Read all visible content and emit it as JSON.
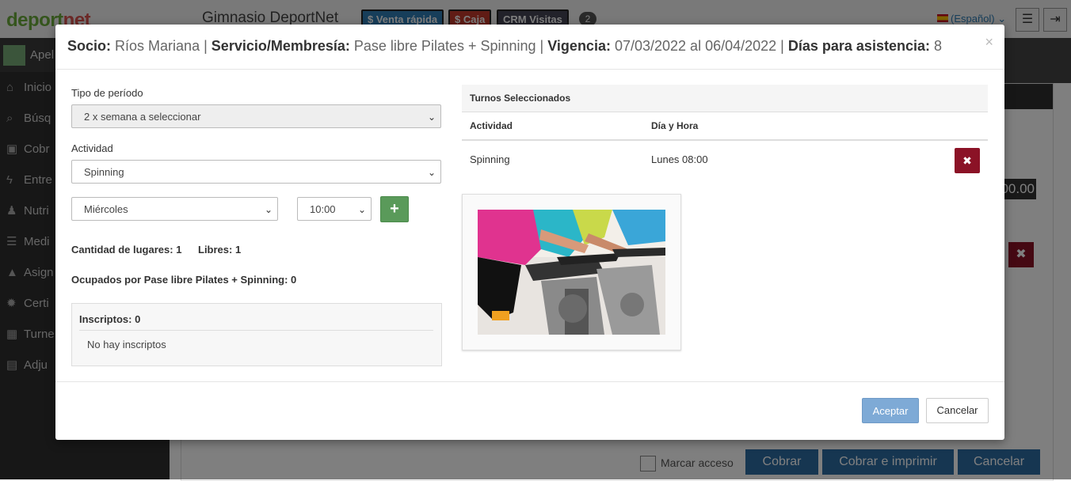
{
  "app": {
    "logo_main": "deport",
    "logo_accent": "net",
    "gym_title": "Gimnasio DeportNet",
    "quick_sale": "$ Venta rápida",
    "cash": "$ Caja",
    "crm": "CRM Visitas",
    "crm_count": "2",
    "language": "(Español)",
    "user_label": "Apel",
    "sidebar": [
      {
        "icon": "home-icon",
        "glyph": "⌂",
        "label": "Inicio"
      },
      {
        "icon": "search-icon",
        "glyph": "⌕",
        "label": "Búsq"
      },
      {
        "icon": "money-icon",
        "glyph": "▣",
        "label": "Cobr"
      },
      {
        "icon": "bolt-icon",
        "glyph": "ϟ",
        "label": "Entre"
      },
      {
        "icon": "user-md-icon",
        "glyph": "♟",
        "label": "Nutri"
      },
      {
        "icon": "list-icon",
        "glyph": "☰",
        "label": "Medi"
      },
      {
        "icon": "graduation-icon",
        "glyph": "▲",
        "label": "Asign"
      },
      {
        "icon": "certificate-icon",
        "glyph": "✹",
        "label": "Certi"
      },
      {
        "icon": "calendar-icon",
        "glyph": "▦",
        "label": "Turne"
      },
      {
        "icon": "file-icon",
        "glyph": "▤",
        "label": "Adju"
      }
    ],
    "bg_amount": "00.00",
    "marcar_acceso": "Marcar acceso",
    "cobrar": "Cobrar",
    "cobrar_imprimir": "Cobrar e imprimir",
    "cancelar_bg": "Cancelar"
  },
  "modal": {
    "title": {
      "socio_label": "Socio:",
      "socio_value": "Ríos Mariana",
      "servicio_label": "Servicio/Membresía:",
      "servicio_value": "Pase libre Pilates + Spinning",
      "vigencia_label": "Vigencia:",
      "vigencia_value": "07/03/2022 al 06/04/2022",
      "dias_label": "Días para asistencia:",
      "dias_value": "8",
      "sep": "|"
    },
    "tipo_periodo_label": "Tipo de período",
    "tipo_periodo_value": "2 x semana a seleccionar",
    "actividad_label": "Actividad",
    "actividad_value": "Spinning",
    "dia_value": "Miércoles",
    "hora_value": "10:00",
    "cantidad_lugares": "Cantidad de lugares: 1",
    "libres": "Libres: 1",
    "ocupados": "Ocupados por Pase libre Pilates + Spinning: 0",
    "inscriptos_title": "Inscriptos: 0",
    "inscriptos_empty": "No hay inscriptos",
    "turnos": {
      "caption": "Turnos Seleccionados",
      "col_actividad": "Actividad",
      "col_dia_hora": "Día y Hora",
      "rows": [
        {
          "actividad": "Spinning",
          "dia_hora": "Lunes 08:00"
        }
      ]
    },
    "aceptar": "Aceptar",
    "cancelar": "Cancelar",
    "close_glyph": "×"
  }
}
